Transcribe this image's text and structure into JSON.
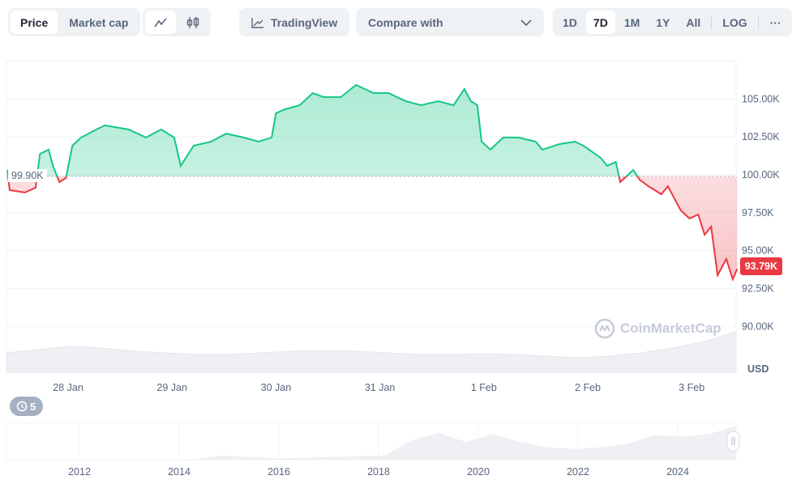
{
  "toolbar": {
    "type_tabs": [
      {
        "label": "Price",
        "active": true
      },
      {
        "label": "Market cap",
        "active": false
      }
    ],
    "chart_style": [
      {
        "icon": "line-chart-icon",
        "active": true
      },
      {
        "icon": "candlestick-icon",
        "active": false
      }
    ],
    "tradingview_label": "TradingView",
    "compare_label": "Compare with",
    "ranges": [
      {
        "label": "1D",
        "active": false
      },
      {
        "label": "7D",
        "active": true
      },
      {
        "label": "1M",
        "active": false
      },
      {
        "label": "1Y",
        "active": false
      },
      {
        "label": "All",
        "active": false
      }
    ],
    "log_label": "LOG",
    "more_label": "···"
  },
  "history_badge": {
    "icon": "history-icon",
    "count": "5"
  },
  "watermark": "CoinMarketCap",
  "colors": {
    "up": "#16c784",
    "down": "#ea3943",
    "volume": "#eef0f3"
  },
  "chart_data": {
    "type": "line",
    "currency_label": "USD",
    "baseline": 99.9,
    "baseline_label": "99.90K",
    "current_label": "93.79K",
    "ylim": [
      88.5,
      108.5
    ],
    "yticks": [
      {
        "v": 105,
        "label": "105.00K"
      },
      {
        "v": 102.5,
        "label": "102.50K"
      },
      {
        "v": 100,
        "label": "100.00K"
      },
      {
        "v": 97.5,
        "label": "97.50K"
      },
      {
        "v": 95,
        "label": "95.00K"
      },
      {
        "v": 92.5,
        "label": "92.50K"
      },
      {
        "v": 90,
        "label": "90.00K"
      }
    ],
    "xticks": [
      {
        "t": "2025-01-28T00:00",
        "label": "28 Jan"
      },
      {
        "t": "2025-01-29T00:00",
        "label": "29 Jan"
      },
      {
        "t": "2025-01-30T00:00",
        "label": "30 Jan"
      },
      {
        "t": "2025-01-31T00:00",
        "label": "31 Jan"
      },
      {
        "t": "2025-02-01T00:00",
        "label": "1 Feb"
      },
      {
        "t": "2025-02-02T00:00",
        "label": "2 Feb"
      },
      {
        "t": "2025-02-03T00:00",
        "label": "3 Feb"
      }
    ],
    "price_k": [
      [
        "2025-01-27T10:00",
        100.32
      ],
      [
        "2025-01-27T10:30",
        98.99
      ],
      [
        "2025-01-27T14:00",
        98.83
      ],
      [
        "2025-01-27T16:30",
        99.15
      ],
      [
        "2025-01-27T17:30",
        101.39
      ],
      [
        "2025-01-27T19:30",
        101.66
      ],
      [
        "2025-01-27T20:30",
        100.59
      ],
      [
        "2025-01-27T22:00",
        99.52
      ],
      [
        "2025-01-27T23:30",
        99.79
      ],
      [
        "2025-01-28T01:00",
        101.92
      ],
      [
        "2025-01-28T03:00",
        102.46
      ],
      [
        "2025-01-28T06:30",
        102.99
      ],
      [
        "2025-01-28T08:30",
        103.26
      ],
      [
        "2025-01-28T14:00",
        102.99
      ],
      [
        "2025-01-28T18:00",
        102.46
      ],
      [
        "2025-01-28T21:30",
        102.99
      ],
      [
        "2025-01-29T00:30",
        102.46
      ],
      [
        "2025-01-29T02:00",
        100.59
      ],
      [
        "2025-01-29T05:00",
        101.92
      ],
      [
        "2025-01-29T09:00",
        102.19
      ],
      [
        "2025-01-29T12:30",
        102.72
      ],
      [
        "2025-01-29T16:30",
        102.46
      ],
      [
        "2025-01-29T20:00",
        102.19
      ],
      [
        "2025-01-29T23:00",
        102.46
      ],
      [
        "2025-01-30T00:00",
        104.06
      ],
      [
        "2025-01-30T02:00",
        104.32
      ],
      [
        "2025-01-30T05:30",
        104.59
      ],
      [
        "2025-01-30T08:30",
        105.39
      ],
      [
        "2025-01-30T11:00",
        105.13
      ],
      [
        "2025-01-30T15:00",
        105.13
      ],
      [
        "2025-01-30T18:30",
        105.93
      ],
      [
        "2025-01-30T22:30",
        105.39
      ],
      [
        "2025-01-31T02:00",
        105.39
      ],
      [
        "2025-01-31T06:00",
        104.86
      ],
      [
        "2025-01-31T09:30",
        104.59
      ],
      [
        "2025-01-31T13:30",
        104.86
      ],
      [
        "2025-01-31T17:00",
        104.59
      ],
      [
        "2025-01-31T19:30",
        105.66
      ],
      [
        "2025-01-31T21:00",
        104.86
      ],
      [
        "2025-01-31T22:30",
        104.59
      ],
      [
        "2025-01-31T23:30",
        102.19
      ],
      [
        "2025-02-01T01:30",
        101.66
      ],
      [
        "2025-02-01T04:30",
        102.46
      ],
      [
        "2025-02-01T08:00",
        102.46
      ],
      [
        "2025-02-01T12:00",
        102.19
      ],
      [
        "2025-02-01T13:30",
        101.66
      ],
      [
        "2025-02-01T17:30",
        102.03
      ],
      [
        "2025-02-01T21:00",
        102.19
      ],
      [
        "2025-02-01T23:00",
        101.92
      ],
      [
        "2025-02-02T03:00",
        101.12
      ],
      [
        "2025-02-02T04:30",
        100.59
      ],
      [
        "2025-02-02T06:30",
        100.85
      ],
      [
        "2025-02-02T07:30",
        99.52
      ],
      [
        "2025-02-02T10:30",
        100.32
      ],
      [
        "2025-02-02T12:00",
        99.68
      ],
      [
        "2025-02-02T14:00",
        99.25
      ],
      [
        "2025-02-02T17:00",
        98.72
      ],
      [
        "2025-02-02T18:30",
        99.25
      ],
      [
        "2025-02-02T21:30",
        97.65
      ],
      [
        "2025-02-02T23:30",
        97.12
      ],
      [
        "2025-02-03T01:30",
        97.38
      ],
      [
        "2025-02-03T03:00",
        96.05
      ],
      [
        "2025-02-03T04:30",
        96.58
      ],
      [
        "2025-02-03T06:00",
        93.38
      ],
      [
        "2025-02-03T08:00",
        94.45
      ],
      [
        "2025-02-03T09:30",
        93.11
      ],
      [
        "2025-02-03T10:30",
        93.79
      ]
    ],
    "volume_relative": [
      0.35,
      0.45,
      0.55,
      0.5,
      0.4,
      0.35,
      0.3,
      0.3,
      0.35,
      0.4,
      0.42,
      0.4,
      0.35,
      0.3,
      0.3,
      0.32,
      0.3,
      0.25,
      0.2,
      0.25,
      0.35,
      0.5,
      0.7,
      1.0
    ],
    "navigator": {
      "xticks": [
        "2012",
        "2014",
        "2016",
        "2018",
        "2020",
        "2022",
        "2024"
      ],
      "price_relative": [
        0,
        0,
        0,
        0,
        0,
        0,
        0.01,
        0.02,
        0.12,
        0.08,
        0.04,
        0.05,
        0.08,
        0.1,
        0.12,
        0.55,
        0.75,
        0.5,
        0.72,
        0.5,
        0.35,
        0.3,
        0.35,
        0.45,
        0.7,
        0.65,
        0.72,
        0.95
      ]
    }
  }
}
